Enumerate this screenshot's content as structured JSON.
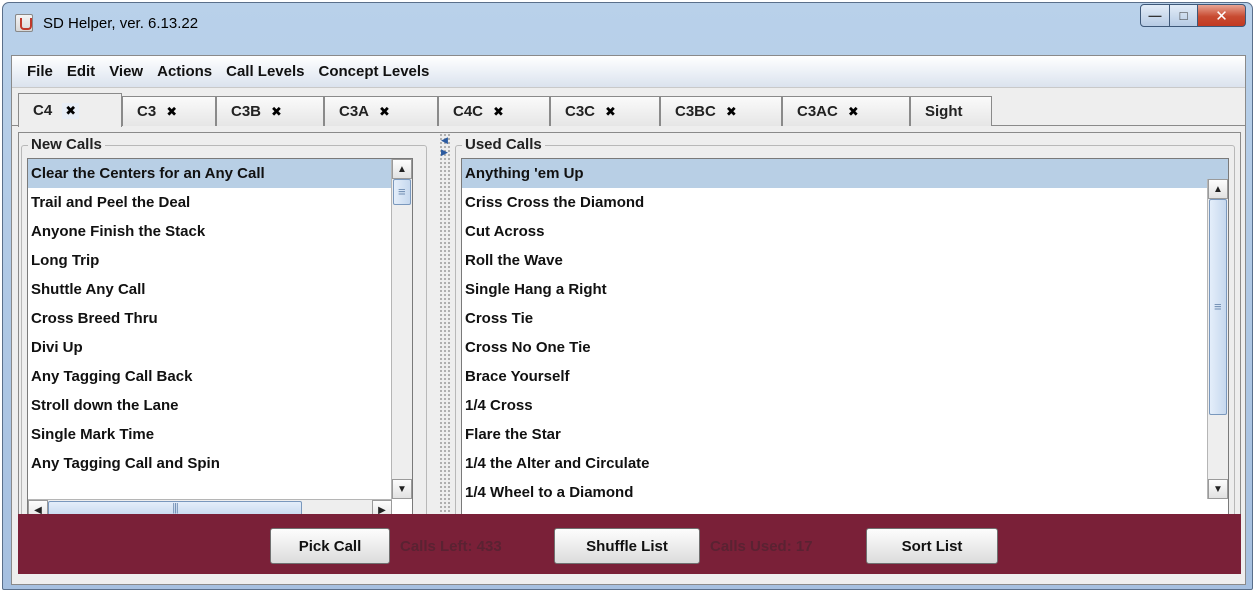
{
  "window": {
    "title": "SD Helper, ver. 6.13.22",
    "min": "—",
    "max": "□",
    "close": "✕",
    "app_icon": "java-cup-icon"
  },
  "menu": [
    "File",
    "Edit",
    "View",
    "Actions",
    "Call Levels",
    "Concept Levels"
  ],
  "tabs": [
    {
      "label": "C4",
      "close": "✖"
    },
    {
      "label": "C3",
      "close": "✖"
    },
    {
      "label": "C3B",
      "close": "✖"
    },
    {
      "label": "C3A",
      "close": "✖"
    },
    {
      "label": "C4C",
      "close": "✖"
    },
    {
      "label": "C3C",
      "close": "✖"
    },
    {
      "label": "C3BC",
      "close": "✖"
    },
    {
      "label": "C3AC",
      "close": "✖"
    },
    {
      "label": "Sight"
    }
  ],
  "active_tab": "C4",
  "new_calls": {
    "title": "New Calls",
    "items": [
      "Clear the Centers for an Any Call",
      "Trail and Peel the Deal",
      "Anyone Finish the Stack",
      "Long Trip",
      "Shuttle Any Call",
      "Cross Breed Thru",
      "Divi Up",
      "Any Tagging Call Back",
      "Stroll down the Lane",
      "Single Mark Time",
      "Any Tagging Call and Spin"
    ],
    "selected_index": 0
  },
  "used_calls": {
    "title": "Used Calls",
    "items": [
      "Anything 'em Up",
      "Criss Cross the Diamond",
      "Cut Across",
      "Roll the Wave",
      "Single Hang a Right",
      "Cross Tie",
      "Cross No One Tie",
      "Brace Yourself",
      "1/4 Cross",
      "Flare the Star",
      "1/4 the Alter and Circulate",
      "1/4 Wheel to a Diamond"
    ],
    "selected_index": 0
  },
  "scroll": {
    "up": "▲",
    "down": "▼",
    "left": "◀",
    "right": "▶"
  },
  "splitter": {
    "left_arrow": "◀",
    "right_arrow": "▶"
  },
  "bottom": {
    "pick_call": "Pick Call",
    "calls_left": "Calls Left: 433",
    "shuffle_list": "Shuffle List",
    "calls_used": "Calls Used: 17",
    "sort_list": "Sort List"
  },
  "colors": {
    "bottom_bar": "#7a2038",
    "selection": "#b8cfe5",
    "counter_text": "#5a2232"
  }
}
